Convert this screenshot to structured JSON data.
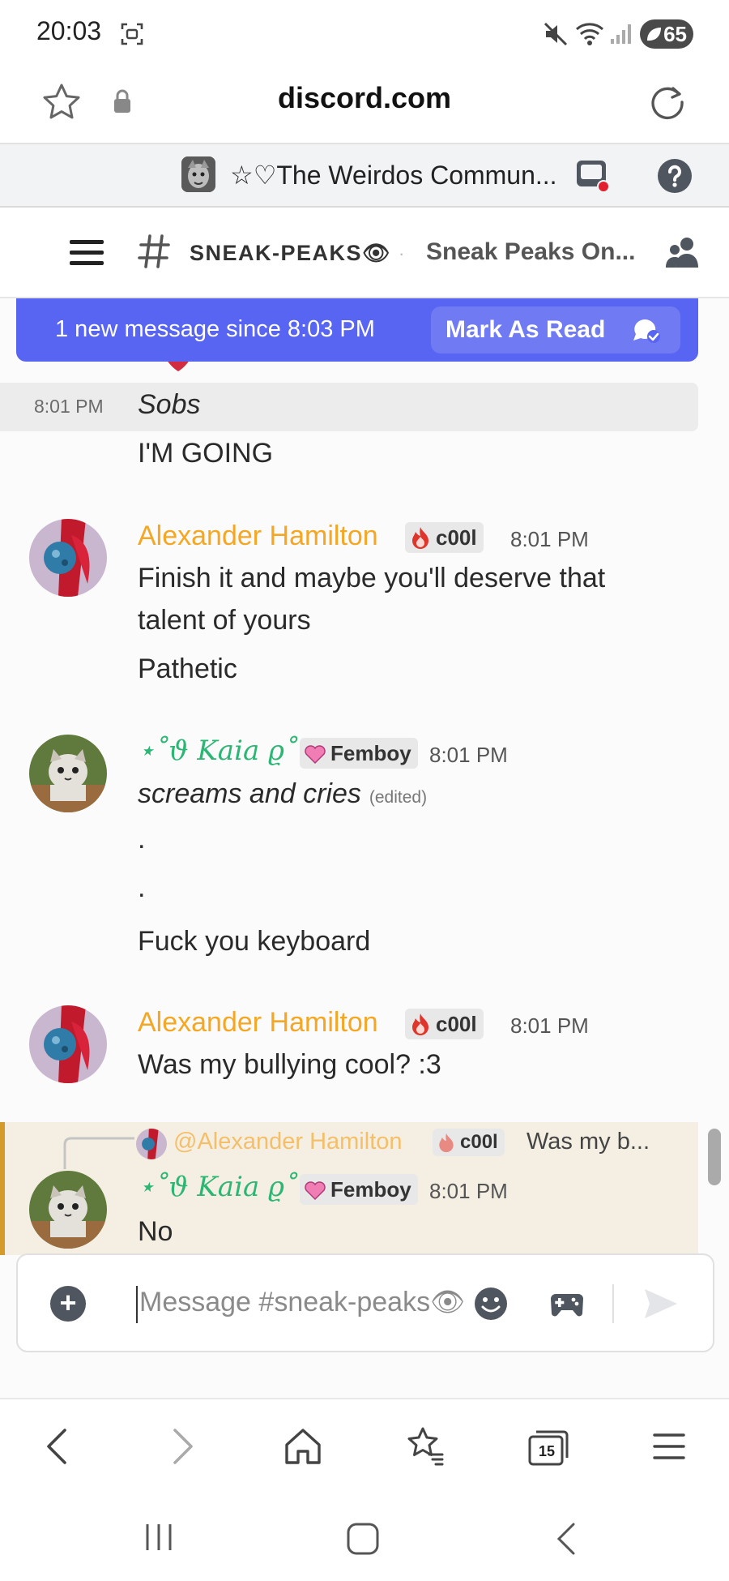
{
  "status_bar": {
    "time": "20:03",
    "battery": "65"
  },
  "browser": {
    "url": "discord.com",
    "tab_count": "15"
  },
  "server": {
    "name": "☆♡The Weirdos Commun..."
  },
  "channel": {
    "name": "sneak-peaks👁",
    "topic": "Sneak Peaks On..."
  },
  "banner": {
    "text": "1 new message since 8:03 PM",
    "mark_as_read": "Mark As Read"
  },
  "messages": [
    {
      "time": "8:01 PM",
      "text": "Sobs"
    },
    {
      "text": "I'M GOING"
    },
    {
      "username": "Alexander Hamilton",
      "tag": "c00l",
      "time": "8:01 PM",
      "lines": [
        "Finish it and maybe you'll deserve that",
        "talent of yours",
        "Pathetic"
      ]
    },
    {
      "username": "⋆˚ϑ Kaia ϱ˚⋆",
      "tag": "Femboy",
      "time": "8:01 PM",
      "lines": [
        "screams and cries",
        ".",
        ".",
        "Fuck you keyboard"
      ],
      "edited": "(edited)"
    },
    {
      "username": "Alexander Hamilton",
      "tag": "c00l",
      "time": "8:01 PM",
      "lines": [
        "Was my bullying cool? :3"
      ]
    },
    {
      "reply_to": "@Alexander Hamilton",
      "reply_tag": "c00l",
      "reply_snippet": "Was my b...",
      "username": "⋆˚ϑ Kaia ϱ˚⋆",
      "tag": "Femboy",
      "time": "8:01 PM",
      "lines": [
        "No"
      ]
    }
  ],
  "composer": {
    "placeholder": "Message #sneak-peaks👁"
  },
  "colors": {
    "blurple": "#5865f2",
    "alex_name": "#f5a623",
    "kaia_name": "#2bb673",
    "reply_bar": "#d49b2a"
  }
}
